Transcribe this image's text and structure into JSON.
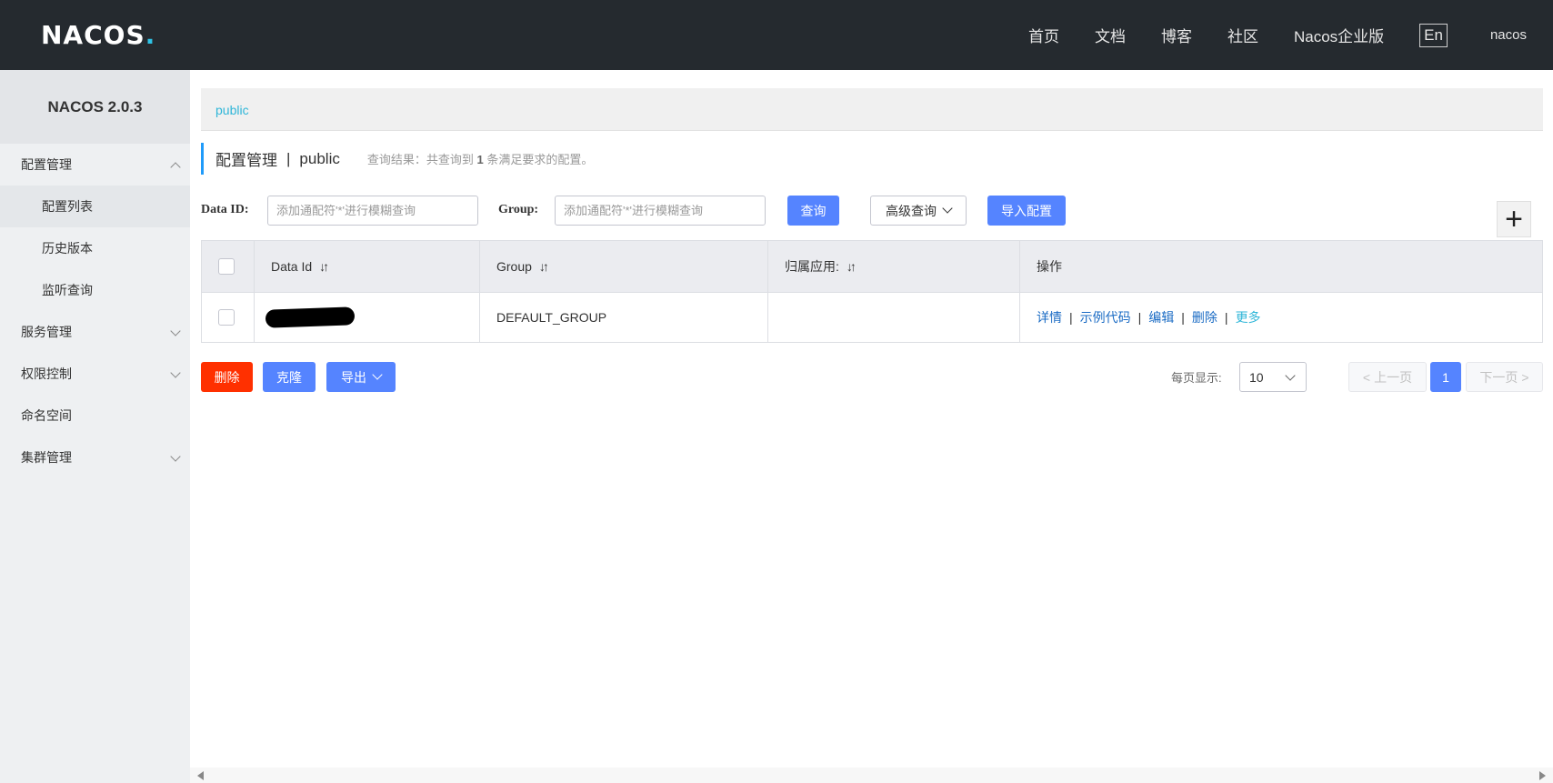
{
  "header": {
    "logo_main": "NACOS",
    "logo_dot": ".",
    "nav": [
      "首页",
      "文档",
      "博客",
      "社区",
      "Nacos企业版"
    ],
    "lang": "En",
    "user": "nacos"
  },
  "sidebar": {
    "title": "NACOS 2.0.3",
    "items": [
      {
        "label": "配置管理",
        "expanded": true
      },
      {
        "label": "配置列表",
        "active": true
      },
      {
        "label": "历史版本"
      },
      {
        "label": "监听查询"
      },
      {
        "label": "服务管理"
      },
      {
        "label": "权限控制"
      },
      {
        "label": "命名空间"
      },
      {
        "label": "集群管理"
      }
    ]
  },
  "main": {
    "breadcrumb": "public",
    "title": "配置管理",
    "separator": "|",
    "namespace": "public",
    "result_prefix": "查询结果：共查询到",
    "result_count": "1",
    "result_suffix": "条满足要求的配置。",
    "filters": {
      "data_id_label": "Data ID:",
      "data_id_placeholder": "添加通配符'*'进行模糊查询",
      "group_label": "Group:",
      "group_placeholder": "添加通配符'*'进行模糊查询",
      "search_button": "查询",
      "advanced_button": "高级查询",
      "import_button": "导入配置",
      "add_symbol": "+"
    },
    "table": {
      "columns": [
        "Data Id",
        "Group",
        "归属应用:",
        "操作"
      ],
      "sort_symbol": "↓↑",
      "rows": [
        {
          "group": "DEFAULT_GROUP",
          "app": ""
        }
      ],
      "actions": [
        "详情",
        "示例代码",
        "编辑",
        "删除",
        "更多"
      ],
      "action_sep": "|"
    },
    "bulk": {
      "delete": "删除",
      "clone": "克隆",
      "export": "导出"
    },
    "pagination": {
      "page_size_label": "每页显示:",
      "page_size": "10",
      "prev": "上一页",
      "current": "1",
      "next": "下一页"
    }
  },
  "colors": {
    "topbar": "#252a2f",
    "primary": "#5584ff",
    "danger": "#ff3000",
    "link": "#1a6bc4",
    "accent": "#2fb6d8"
  }
}
